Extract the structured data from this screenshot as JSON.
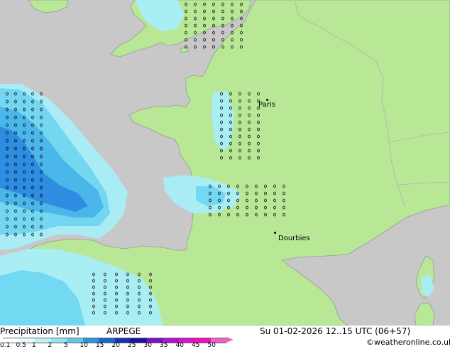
{
  "map": {
    "colors": {
      "sea": "#c8c8c8",
      "land": "#b8e896",
      "coast": "#999999",
      "border": "#b0b0b0",
      "rain_light": "#a8eef8",
      "rain_mid": "#70d6f0",
      "rain_heavy": "#48b4e8",
      "rain_strong": "#2c8ae0"
    },
    "cities": [
      {
        "name": "Paris"
      },
      {
        "name": "Dourbies"
      }
    ]
  },
  "footer": {
    "title": "Precipitation [mm]",
    "model": "ARPEGE",
    "datetime": "Su 01-02-2026 12..15 UTC (06+57)",
    "copyright": "©weatheronline.co.uk",
    "colorbar": {
      "ticks": [
        "0.1",
        "0.5",
        "1",
        "2",
        "5",
        "10",
        "15",
        "20",
        "25",
        "30",
        "35",
        "40",
        "45",
        "50"
      ],
      "colors": [
        "#ffffff",
        "#e6faff",
        "#c2f0fa",
        "#94e2f4",
        "#5ec8ec",
        "#2c94e0",
        "#1c64d0",
        "#1430b4",
        "#2010a0",
        "#7c10c4",
        "#b410d0",
        "#dc10d0",
        "#f010c0",
        "#f060c8"
      ]
    }
  }
}
